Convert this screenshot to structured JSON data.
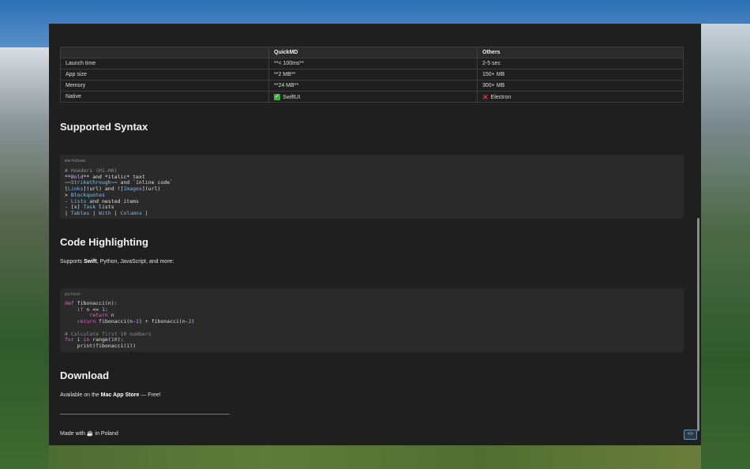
{
  "comparison_table": {
    "headers": [
      "",
      "QuickMD",
      "Others"
    ],
    "rows": [
      [
        "Launch time",
        "**< 100ms**",
        "2-5 sec"
      ],
      [
        "App size",
        "**2 MB**",
        "150+ MB"
      ],
      [
        "Memory",
        "**24 MB**",
        "300+ MB"
      ],
      [
        "Native",
        "SwiftUI",
        "Electron"
      ]
    ]
  },
  "sections": {
    "syntax_heading": "Supported Syntax",
    "code_heading": "Code Highlighting",
    "download_heading": "Download"
  },
  "markdown_block": {
    "lang": "markdown",
    "lines": [
      "# Headers (H1-H6)",
      "**Bold** and *italic* text",
      "~~Strikethrough~~ and `inline code`",
      "[Links](url) and ![Images](url)",
      "> Blockquotes",
      "- Lists and nested items",
      "- [x] Task lists",
      "| Tables | With | Columns |"
    ]
  },
  "code_text": {
    "prefix": "Supports ",
    "bold": "Swift",
    "suffix": ", Python, JavaScript, and more:"
  },
  "python_block": {
    "lang": "python",
    "lines": [
      "def fibonacci(n):",
      "    if n <= 1:",
      "        return n",
      "    return fibonacci(n-1) + fibonacci(n-2)",
      "",
      "# Calculate first 10 numbers",
      "for i in range(10):",
      "    print(fibonacci(i))"
    ]
  },
  "download_text": {
    "prefix": "Available on the ",
    "bold": "Mac App Store",
    "suffix": " — Free!"
  },
  "footer": {
    "prefix": "Made with ",
    "emoji": "☕",
    "suffix": " in Poland"
  },
  "corner_button": "<>",
  "icons": {
    "check": "check-mark-icon",
    "cross": "cross-mark-icon",
    "coffee": "coffee-icon"
  },
  "colors": {
    "window_bg": "#1f1f1f",
    "code_bg": "#2a2a2a",
    "keyword": "#e06cc8",
    "comment": "#8c8c8c",
    "link": "#7fb5e8"
  }
}
